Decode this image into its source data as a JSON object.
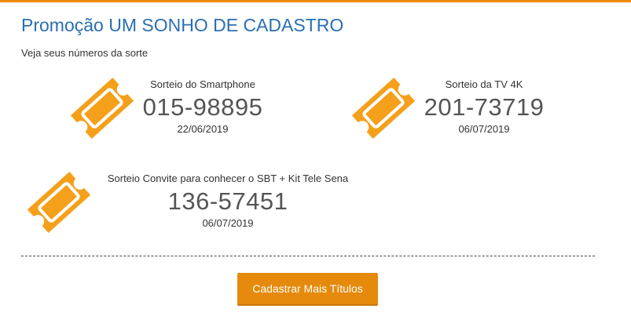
{
  "page": {
    "title": "Promoção UM SONHO DE CADASTRO",
    "subtitle": "Veja seus números da sorte"
  },
  "prizes": [
    {
      "name": "Sorteio do Smartphone",
      "number": "015-98895",
      "date": "22/06/2019",
      "icon": "ticket-icon"
    },
    {
      "name": "Sorteio da TV 4K",
      "number": "201-73719",
      "date": "06/07/2019",
      "icon": "ticket-icon"
    },
    {
      "name": "Sorteio Convite para conhecer o SBT + Kit Tele Sena",
      "number": "136-57451",
      "date": "06/07/2019",
      "icon": "ticket-icon"
    }
  ],
  "actions": {
    "register_more_label": "Cadastrar Mais Títulos"
  },
  "colors": {
    "accent": "#f5a01a",
    "title": "#2a6fb0",
    "button": "#e58a0c"
  }
}
